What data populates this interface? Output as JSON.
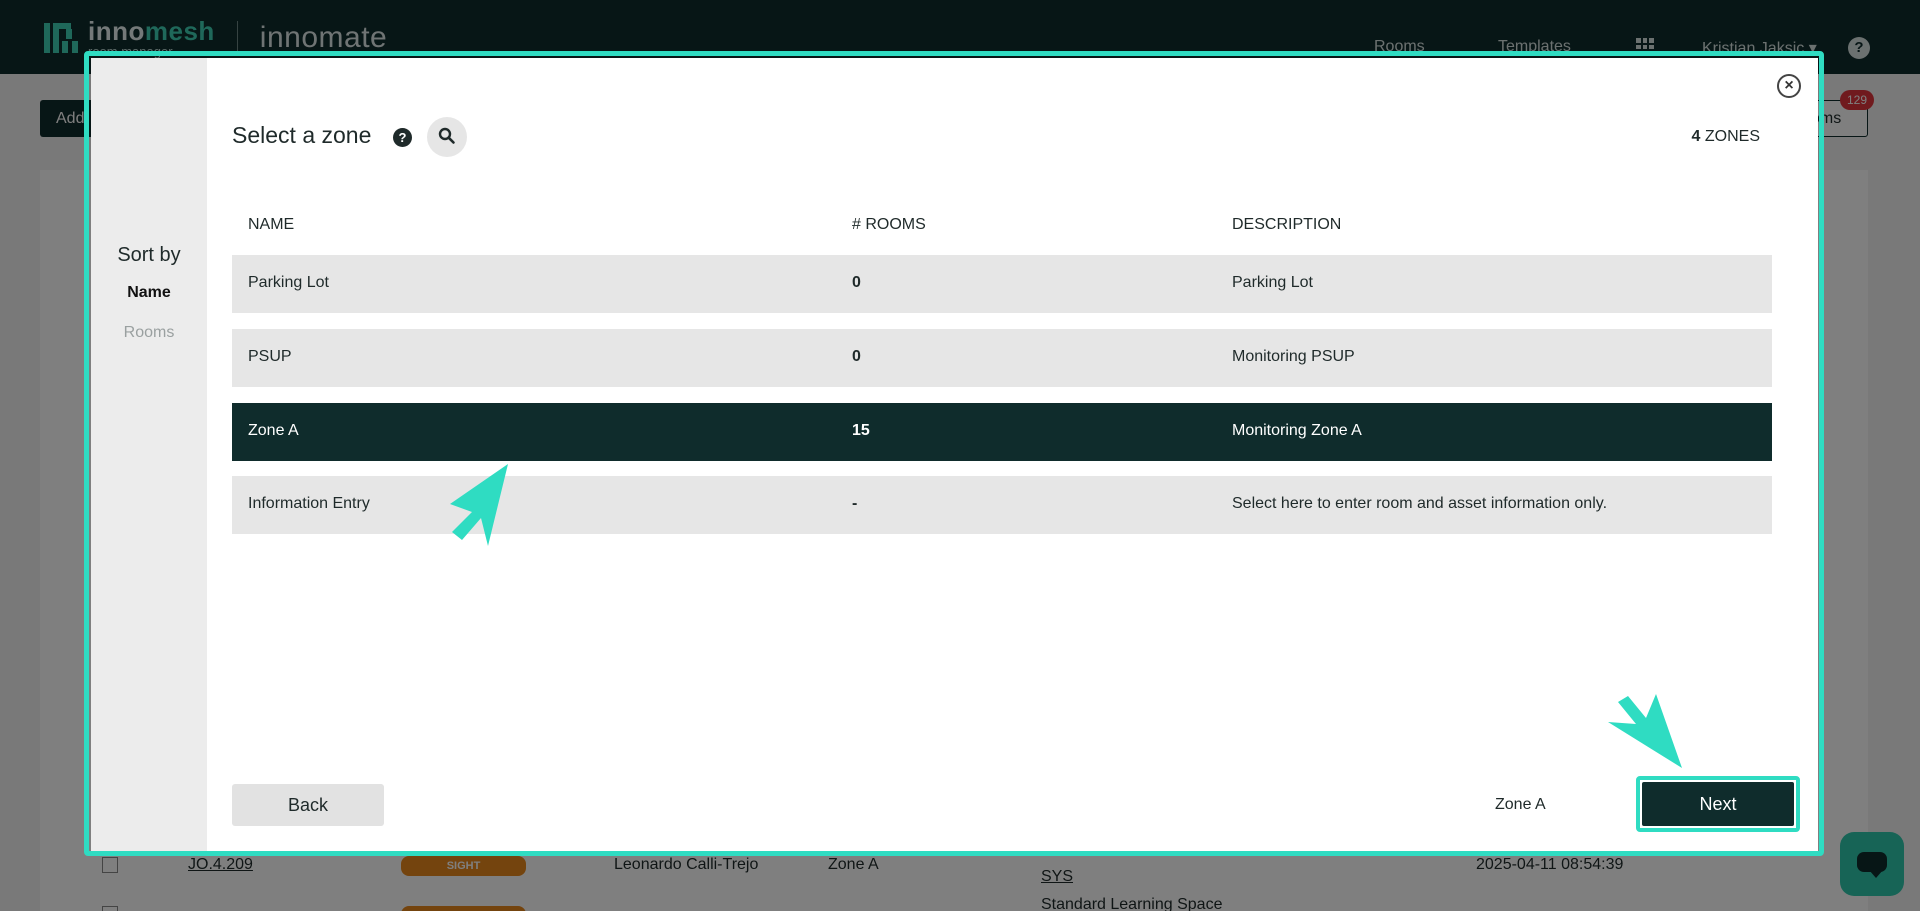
{
  "app": {
    "brand_main": "inno",
    "brand_accent": "mesh",
    "brand_sub": "room manager",
    "product": "innomate",
    "nav": [
      {
        "label": "Rooms"
      },
      {
        "label": "Templates"
      },
      {
        "label": "Kristian Jaksic ▾"
      }
    ],
    "add_label": "Add",
    "rooms_label": "oms",
    "rooms_badge": "129",
    "rows": [
      {
        "id": "JO.4.209",
        "tag": "SIGHT",
        "person": "Leonardo Calli-Trejo",
        "zone": "Zone A",
        "type": "SYS",
        "date": "2025-04-11 08:54:39"
      },
      {
        "extra": "Standard Learning Space"
      }
    ]
  },
  "modal": {
    "title": "Select a zone",
    "zone_count": "4",
    "zone_count_suffix": "ZONES",
    "sort": {
      "title": "Sort by",
      "options": [
        "Name",
        "Rooms"
      ]
    },
    "columns": [
      "NAME",
      "# ROOMS",
      "DESCRIPTION"
    ],
    "rows": [
      {
        "name": "Parking Lot",
        "rooms": "0",
        "description": "Parking Lot"
      },
      {
        "name": "PSUP",
        "rooms": "0",
        "description": "Monitoring PSUP"
      },
      {
        "name": "Zone A",
        "rooms": "15",
        "description": "Monitoring Zone A"
      },
      {
        "name": "Information Entry",
        "rooms": "-",
        "description": "Select here to enter room and asset information only."
      }
    ],
    "selected_zone": "Zone A",
    "back_label": "Back",
    "next_label": "Next"
  },
  "colors": {
    "brand_dark": "#0f2c2c",
    "accent_teal": "#2fdcc2",
    "row_bg": "#e6e6e6"
  }
}
